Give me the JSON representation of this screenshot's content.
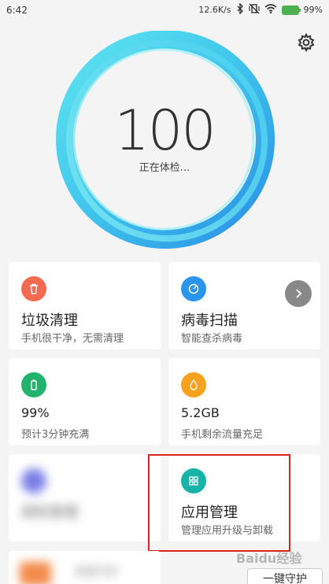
{
  "status": {
    "time": "6:42",
    "speed": "12.6K/s",
    "battery": "99%"
  },
  "score": {
    "value": "100",
    "label": "正在体检..."
  },
  "cards": {
    "junk": {
      "title": "垃圾清理",
      "subtitle": "手机很干净，无需清理"
    },
    "virus": {
      "title": "病毒扫描",
      "subtitle": "智能查杀病毒"
    },
    "battery": {
      "title": "99%",
      "subtitle": "预计3分钟充满"
    },
    "data": {
      "title": "5.2GB",
      "subtitle": "手机剩余流量充足"
    },
    "blurred_left": {
      "title": "授权管理",
      "subtitle": ""
    },
    "apps": {
      "title": "应用管理",
      "subtitle": "管理应用升级与卸载"
    },
    "bottom_left": {
      "title": "家庭守护"
    }
  },
  "buttons": {
    "one_key": "一键守护"
  },
  "watermark": "Baidu经验",
  "colors": {
    "junk_icon": "#f26a4f",
    "virus_icon": "#2b95ec",
    "battery_icon": "#21b26b",
    "data_icon": "#f7a21e",
    "apps_icon": "#17b3a6",
    "blur_icon": "#7a7fe6",
    "highlight": "#d9231e"
  }
}
